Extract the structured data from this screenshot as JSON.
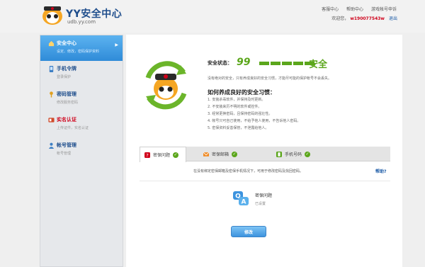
{
  "header": {
    "logo_title": "YY安全中心",
    "logo_domain": "udb.yy.com",
    "links": [
      "客服中心",
      "帮助中心",
      "游戏帐号申诉"
    ],
    "welcome_prefix": "欢迎您，",
    "username": "w190077543w",
    "logout": "退出"
  },
  "sidebar": {
    "items": [
      {
        "title": "安全中心",
        "sub": "设定、修改，密码保护资料",
        "icon": "home-icon"
      },
      {
        "title": "手机令牌",
        "sub": "登录保护",
        "icon": "phone-icon"
      },
      {
        "title": "密码管理",
        "sub": "修改服务密码",
        "icon": "key-icon"
      },
      {
        "title": "实名认证",
        "sub": "上传证件，实名认证",
        "icon": "id-card-icon"
      },
      {
        "title": "帐号管理",
        "sub": "帐号管理",
        "icon": "user-icon"
      }
    ]
  },
  "status": {
    "label": "安全状态：",
    "score": "99",
    "level_filled": 5,
    "level_total": 5,
    "text": "安全",
    "desc": "没有绝对的安全，只有养成良好的安全习惯，才能尽可能的保护帐号不会丢失。",
    "habits_title": "如何养成良好的安全习惯：",
    "tips": [
      "1.  安装杀毒软件，并保持及时更新。",
      "2.  不安装来历不明的软件或控件。",
      "3.  经常更换密码，且保持密码的强壮性。",
      "4.  帐号只可自己使用，不给予他人使用，不告诉他人密码。",
      "5.  密保资料妥善保管，不泄露给他人。"
    ]
  },
  "tabs": [
    {
      "label": "密保问题",
      "icon": "question-icon"
    },
    {
      "label": "密保邮箱",
      "icon": "mail-icon"
    },
    {
      "label": "手机号码",
      "icon": "mobile-icon"
    }
  ],
  "tab_content": {
    "desc": "在没有绑定密保邮箱及密保手机情况下，可用于修改密码及找回密码。",
    "help": "帮助?",
    "item_title": "密保问题",
    "item_status": "已设置",
    "button": "修改"
  },
  "colors": {
    "accent": "#2f8bd8",
    "safe_green": "#5ba61b",
    "danger": "#d0021b"
  }
}
